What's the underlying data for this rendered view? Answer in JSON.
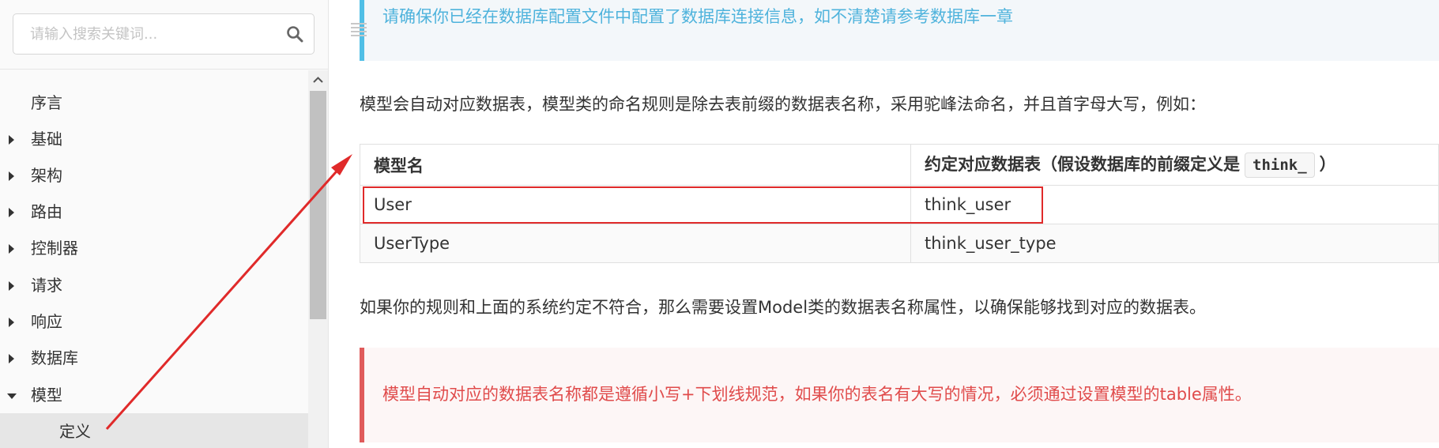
{
  "search": {
    "placeholder": "请输入搜索关键词..."
  },
  "sidebar": {
    "items": [
      {
        "label": "序言",
        "expandable": false
      },
      {
        "label": "基础",
        "expandable": true,
        "expanded": false
      },
      {
        "label": "架构",
        "expandable": true,
        "expanded": false
      },
      {
        "label": "路由",
        "expandable": true,
        "expanded": false
      },
      {
        "label": "控制器",
        "expandable": true,
        "expanded": false
      },
      {
        "label": "请求",
        "expandable": true,
        "expanded": false
      },
      {
        "label": "响应",
        "expandable": true,
        "expanded": false
      },
      {
        "label": "数据库",
        "expandable": true,
        "expanded": false
      },
      {
        "label": "模型",
        "expandable": true,
        "expanded": true
      },
      {
        "label": "定义",
        "expandable": false,
        "active": true
      }
    ]
  },
  "content": {
    "info_note": "请确保你已经在数据库配置文件中配置了数据库连接信息，如不清楚请参考数据库一章",
    "intro": "模型会自动对应数据表，模型类的命名规则是除去表前缀的数据表名称，采用驼峰法命名，并且首字母大写，例如：",
    "table": {
      "headers": [
        "模型名",
        "约定对应数据表（假设数据库的前缀定义是",
        "think_",
        "）"
      ],
      "rows": [
        [
          "User",
          "think_user"
        ],
        [
          "UserType",
          "think_user_type"
        ]
      ]
    },
    "after_table": "如果你的规则和上面的系统约定不符合，那么需要设置Model类的数据表名称属性，以确保能够找到对应的数据表。",
    "warning_note": "模型自动对应的数据表名称都是遵循小写+下划线规范，如果你的表名有大写的情况，必须通过设置模型的table属性。"
  },
  "colors": {
    "info_accent": "#50bfe6",
    "info_text": "#4fb3dc",
    "warn_accent": "#e05b5b",
    "warn_text": "#e04b4b",
    "annotation": "#e02a2a"
  },
  "icons": {
    "search": "search-icon",
    "toc": "menu-icon",
    "scroll_up": "chevron-up-icon",
    "collapsed": "caret-right-icon",
    "expanded": "caret-down-icon"
  }
}
